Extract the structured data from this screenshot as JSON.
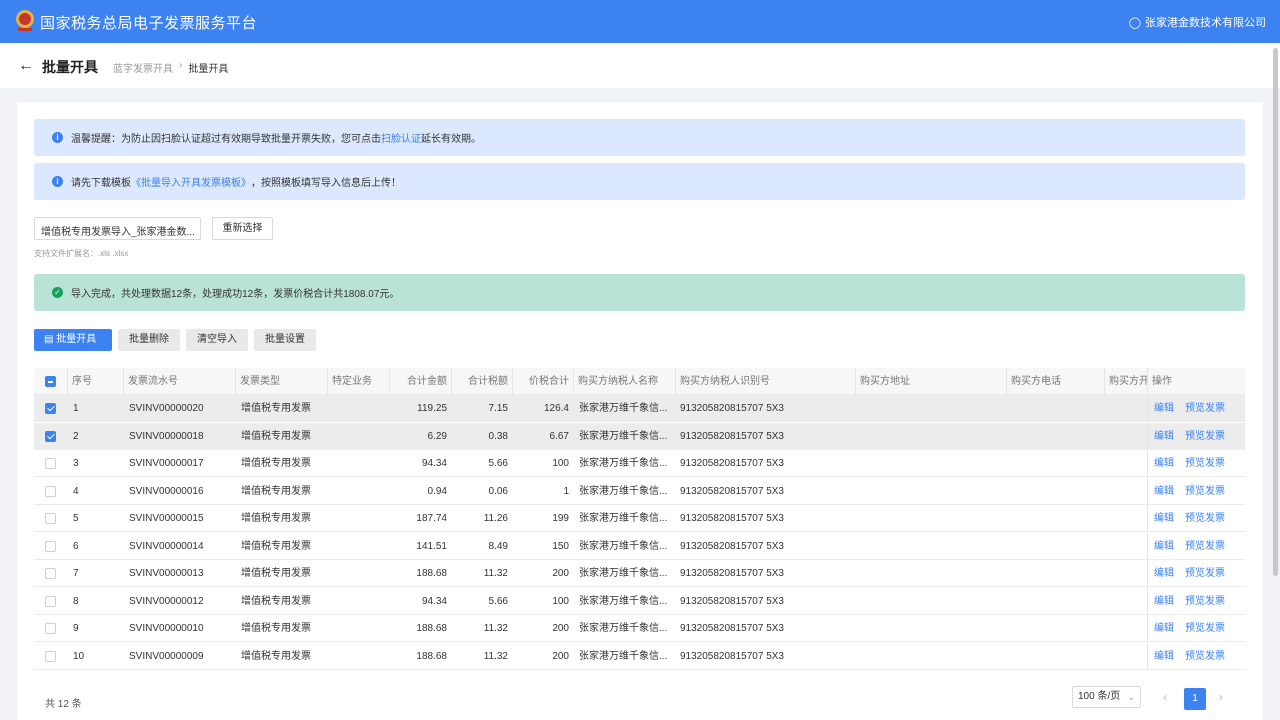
{
  "header": {
    "title": "国家税务总局电子发票服务平台",
    "user": "张家港金数技术有限公司"
  },
  "subheader": {
    "title": "批量开具",
    "breadcrumb": [
      "蓝字发票开具",
      "批量开具"
    ]
  },
  "alerts": {
    "reminder_text": "温馨提醒：为防止因扫脸认证超过有效期导致批量开票失败，您可点击",
    "reminder_link": "扫脸认证",
    "reminder_suffix": "延长有效期。",
    "template_prefix": "请先下载模板",
    "template_link": "《批量导入开具发票模板》",
    "template_suffix": "，按照模板填写导入信息后上传！",
    "success_text": "导入完成，共处理数据12条，处理成功12条，发票价税合计共1808.07元。"
  },
  "upload": {
    "file_name": "增值税专用发票导入_张家港金数...",
    "reselect_label": "重新选择",
    "hint": "支持文件扩展名：.xls .xlsx"
  },
  "toolbar": {
    "batch_issue": "批量开具",
    "batch_delete": "批量删除",
    "clear_import": "清空导入",
    "batch_settings": "批量设置"
  },
  "table": {
    "columns": [
      "序号",
      "发票流水号",
      "发票类型",
      "特定业务",
      "合计金额",
      "合计税额",
      "价税合计",
      "购买方纳税人名称",
      "购买方纳税人识别号",
      "购买方地址",
      "购买方电话",
      "购买方开",
      "操作"
    ],
    "rows": [
      {
        "no": "1",
        "serial": "SVINV00000020",
        "type": "增值税专用发票",
        "amount": "119.25",
        "tax": "7.15",
        "total": "126.4",
        "buyer": "张家港万维千象信...",
        "taxid": "913205820815707 5X3",
        "checked": true
      },
      {
        "no": "2",
        "serial": "SVINV00000018",
        "type": "增值税专用发票",
        "amount": "6.29",
        "tax": "0.38",
        "total": "6.67",
        "buyer": "张家港万维千象信...",
        "taxid": "913205820815707 5X3",
        "checked": true
      },
      {
        "no": "3",
        "serial": "SVINV00000017",
        "type": "增值税专用发票",
        "amount": "94.34",
        "tax": "5.66",
        "total": "100",
        "buyer": "张家港万维千象信...",
        "taxid": "913205820815707 5X3",
        "checked": false
      },
      {
        "no": "4",
        "serial": "SVINV00000016",
        "type": "增值税专用发票",
        "amount": "0.94",
        "tax": "0.06",
        "total": "1",
        "buyer": "张家港万维千象信...",
        "taxid": "913205820815707 5X3",
        "checked": false
      },
      {
        "no": "5",
        "serial": "SVINV00000015",
        "type": "增值税专用发票",
        "amount": "187.74",
        "tax": "11.26",
        "total": "199",
        "buyer": "张家港万维千象信...",
        "taxid": "913205820815707 5X3",
        "checked": false
      },
      {
        "no": "6",
        "serial": "SVINV00000014",
        "type": "增值税专用发票",
        "amount": "141.51",
        "tax": "8.49",
        "total": "150",
        "buyer": "张家港万维千象信...",
        "taxid": "913205820815707 5X3",
        "checked": false
      },
      {
        "no": "7",
        "serial": "SVINV00000013",
        "type": "增值税专用发票",
        "amount": "188.68",
        "tax": "11.32",
        "total": "200",
        "buyer": "张家港万维千象信...",
        "taxid": "913205820815707 5X3",
        "checked": false
      },
      {
        "no": "8",
        "serial": "SVINV00000012",
        "type": "增值税专用发票",
        "amount": "94.34",
        "tax": "5.66",
        "total": "100",
        "buyer": "张家港万维千象信...",
        "taxid": "913205820815707 5X3",
        "checked": false
      },
      {
        "no": "9",
        "serial": "SVINV00000010",
        "type": "增值税专用发票",
        "amount": "188.68",
        "tax": "11.32",
        "total": "200",
        "buyer": "张家港万维千象信...",
        "taxid": "913205820815707 5X3",
        "checked": false
      },
      {
        "no": "10",
        "serial": "SVINV00000009",
        "type": "增值税专用发票",
        "amount": "188.68",
        "tax": "11.32",
        "total": "200",
        "buyer": "张家港万维千象信...",
        "taxid": "913205820815707 5X3",
        "checked": false
      }
    ],
    "edit_label": "编辑",
    "preview_label": "预览发票"
  },
  "pagination": {
    "total": "共 12 条",
    "page_size": "100 条/页",
    "current_page": "1"
  },
  "colors": {
    "primary": "#3c82f0",
    "info_bg": "#dbe8fd",
    "success_bg": "#b9e3d7"
  }
}
